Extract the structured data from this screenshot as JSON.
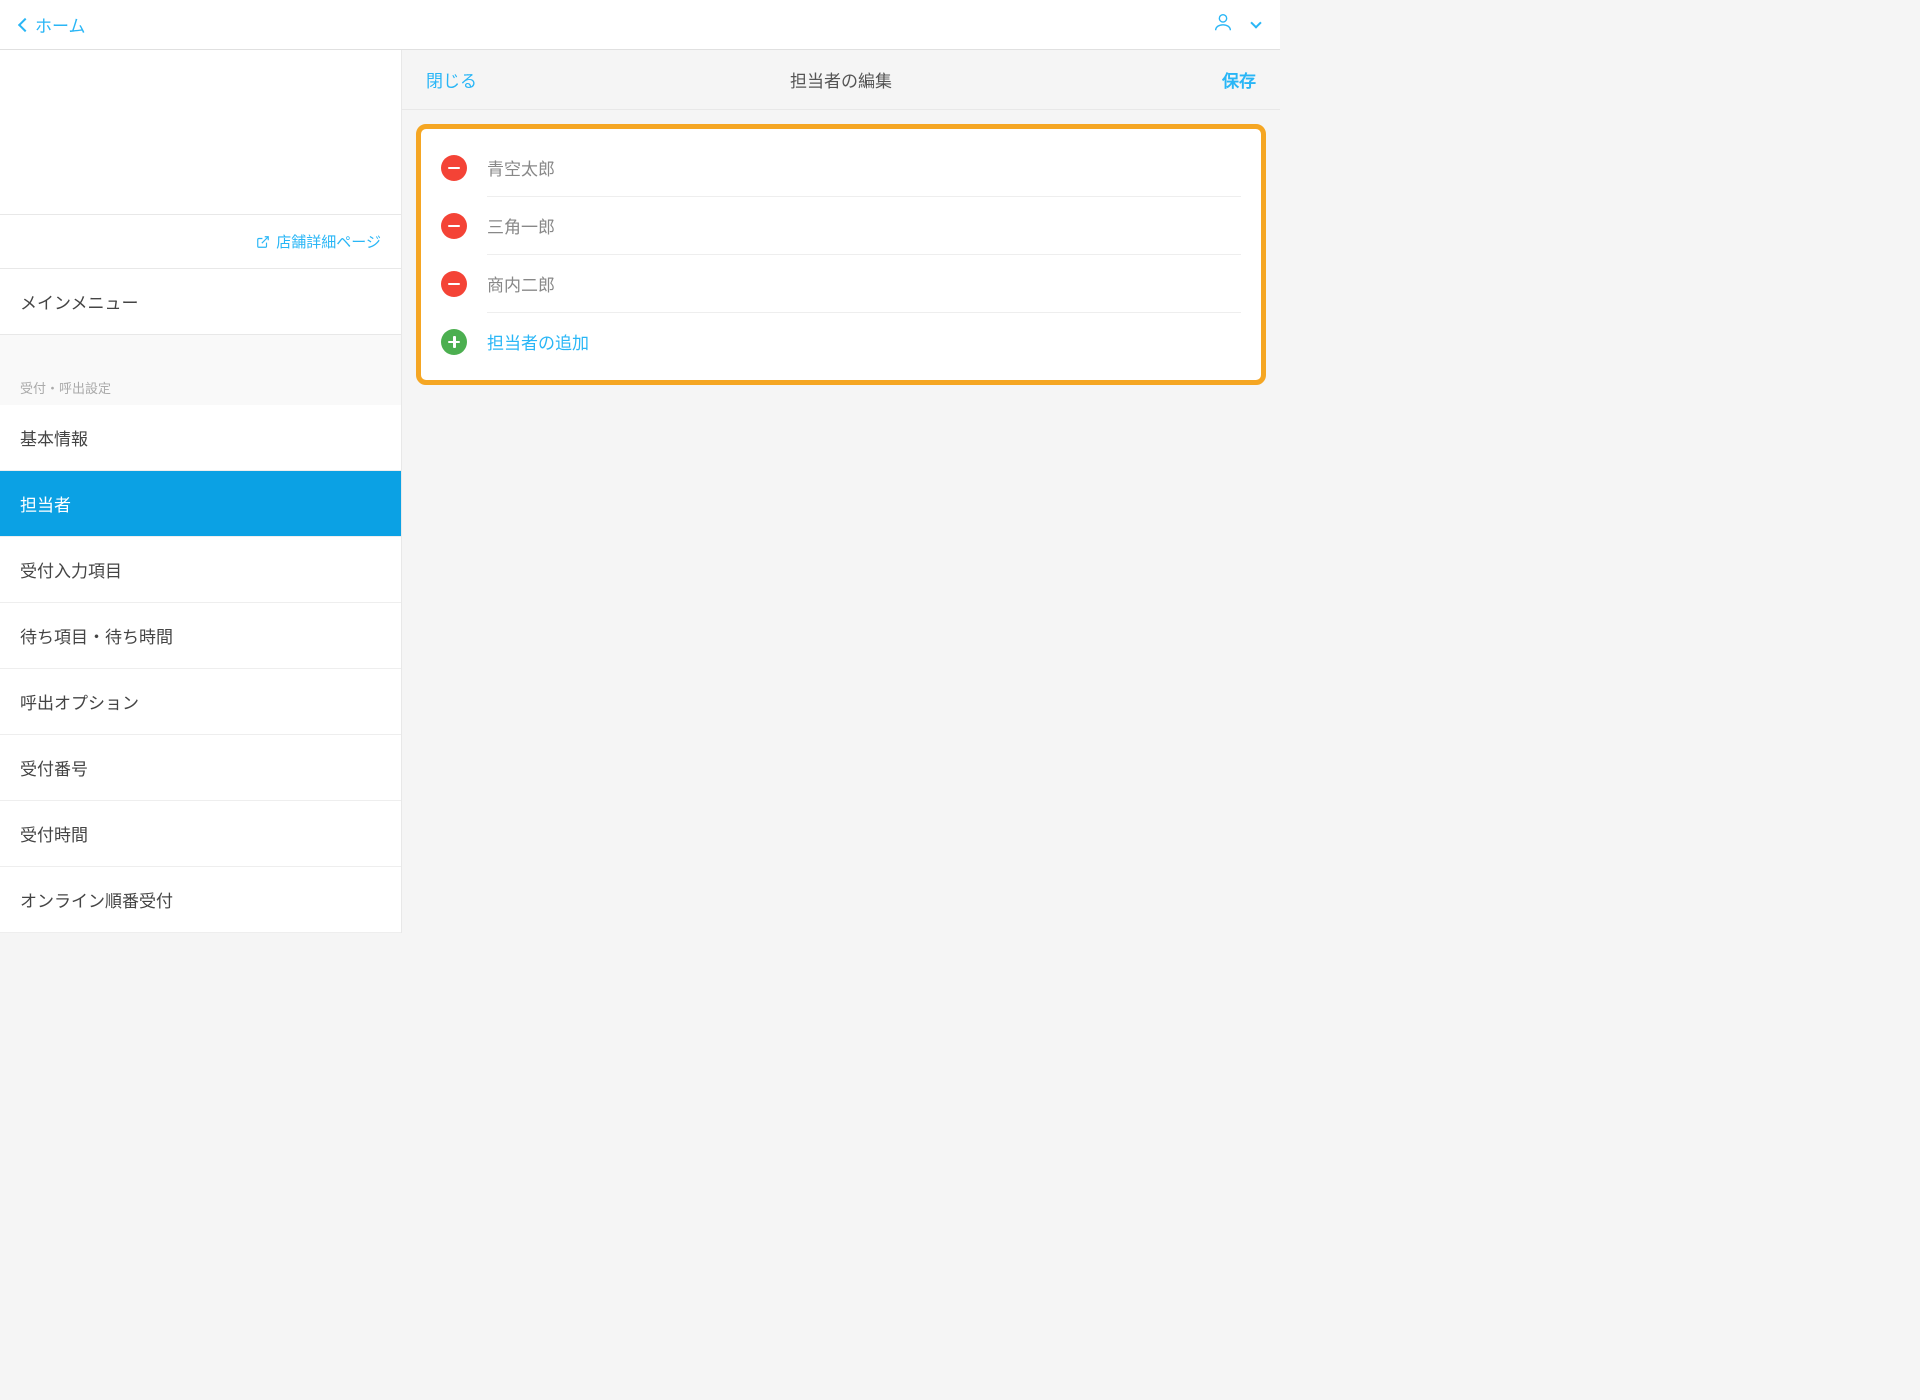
{
  "header": {
    "back_label": "ホーム"
  },
  "sidebar": {
    "store_detail_link": "店舗詳細ページ",
    "main_menu_label": "メインメニュー",
    "section_header": "受付・呼出設定",
    "items": [
      {
        "label": "基本情報",
        "active": false
      },
      {
        "label": "担当者",
        "active": true
      },
      {
        "label": "受付入力項目",
        "active": false
      },
      {
        "label": "待ち項目・待ち時間",
        "active": false
      },
      {
        "label": "呼出オプション",
        "active": false
      },
      {
        "label": "受付番号",
        "active": false
      },
      {
        "label": "受付時間",
        "active": false
      },
      {
        "label": "オンライン順番受付",
        "active": false
      }
    ]
  },
  "content": {
    "close_label": "閉じる",
    "title": "担当者の編集",
    "save_label": "保存",
    "persons": [
      {
        "name": "青空太郎"
      },
      {
        "name": "三角一郎"
      },
      {
        "name": "商内二郎"
      }
    ],
    "add_label": "担当者の追加"
  }
}
